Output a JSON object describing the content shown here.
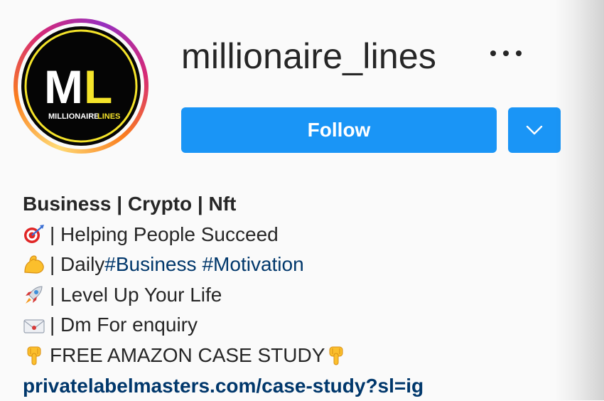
{
  "profile": {
    "username": "millionaire_lines",
    "avatar_text": {
      "monogram_m": "M",
      "monogram_l": "L",
      "word_1": "MILLIONAIRE",
      "word_2": "LINES"
    },
    "follow_label": "Follow",
    "more_icon": "more-horizontal-icon",
    "dropdown_icon": "chevron-down-icon"
  },
  "bio": {
    "name": "Business | Crypto | Nft",
    "lines": [
      {
        "emoji": "direct-hit-icon",
        "text": " | Helping People Succeed"
      },
      {
        "emoji": "flexed-biceps-icon",
        "text": " | Daily ",
        "hashtags": [
          "#Business",
          "#Motivation"
        ]
      },
      {
        "emoji": "rocket-icon",
        "text": " | Level Up Your Life"
      },
      {
        "emoji": "envelope-icon",
        "text": " | Dm For enquiry"
      },
      {
        "emoji": "backhand-pointing-down-icon",
        "text": " FREE AMAZON CASE STUDY "
      }
    ],
    "link": "privatelabelmasters.com/case-study?sl=ig"
  },
  "colors": {
    "follow_blue": "#1a95f6",
    "link_blue": "#00376b",
    "text": "#262626",
    "background": "#fafafa",
    "avatar_yellow": "#f5e42a"
  }
}
